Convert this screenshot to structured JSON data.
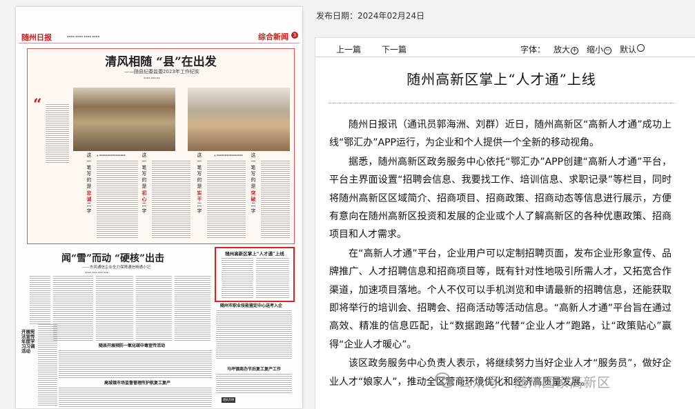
{
  "publish_date": "发布日期：2024年02月24日",
  "toolbar": {
    "prev_label": "上一篇",
    "next_label": "下一篇",
    "font_label": "字体：",
    "enlarge_label": "放大",
    "shrink_label": "缩小",
    "default_label": "默认"
  },
  "article": {
    "title": "随州高新区掌上“人才通”上线",
    "paragraphs": [
      "随州日报讯（通讯员郭海洲、刘群）近日，随州高新区“高新人才通”成功上线“鄂汇办”APP运行，为企业和个人提供一个全新的移动视角。",
      "据悉，随州高新区政务服务中心依托“鄂汇办”APP创建“高新人才通”平台，平台主界面设置“招聘会信息、我要找工作、培训信息、求职记录”等栏目，同时将随州高新区区域简介、招商项目、招商政策、招商动态等信息进行展示，方便有意向在随州高新区投资和发展的企业或个人了解高新区的各种优惠政策、招商项目和人才需求。",
      "在“高新人才通”平台，企业用户可以定制招聘页面，发布企业形象宣传、品牌推广、人才招聘信息和招商项目等，既有针对性地吸引所需人才，又拓宽合作渠道，加速项目落地。个人不仅可以手机浏览和申请最新的招聘信息，还能获取即将举行的培训会、招聘会、招商活动等活动信息。“高新人才通”平台旨在通过高效、精准的信息匹配，让“数据跑路”代替“企业人才”跑路，让“政策贴心”赢得“企业人才暖心”。",
      "该区政务服务中心负责人表示，将继续努力当好企业人才“服务员”，做好企业人才“娘家人”，推动全区营商环境优化和经济高质量发展。"
    ]
  },
  "watermark": "公众号 · 随州国家高新区",
  "newspaper": {
    "logo": "随州日报",
    "section": "综合新闻",
    "page_number": "3",
    "feature_headline": "清风相随 “县”在出发",
    "feature_subhead": "——随县纪委监委2023年工作纪实",
    "quote_mark": "“",
    "column_texts": [
      [
        "这",
        "一",
        "笔",
        "写",
        "的",
        "是",
        "忠",
        "诚",
        "二",
        "字"
      ],
      [
        "这",
        "一",
        "笔",
        "写",
        "的",
        "是",
        "初",
        "心",
        "二",
        "字"
      ],
      [
        "这",
        "一",
        "笔",
        "写",
        "的",
        "是",
        "实",
        "干",
        "二",
        "字"
      ],
      [
        "这",
        "一",
        "笔",
        "写",
        "的",
        "是",
        "突",
        "破",
        "二",
        "字"
      ]
    ],
    "story2_headline": "闻“雪”而动 “硬核”出击",
    "story2_subhead": "——东风通信企业全力保障通信畅通小记",
    "highlight_title": "随州高新区掌上“人才通”上线",
    "story3_headline": "随州市职业技能鉴定中心送考入企",
    "story4_headline": "随县开展预防一氧化碳中毒宣传活动",
    "story5_headline": "马坪镇商办节后复工复产工作",
    "story6_headline": "高城镇市场监督管理所护航复工复产",
    "left_vertical_headline": "开展宪法宣传年度学习习调活动",
    "notice_label": "遗失声明"
  },
  "colors": {
    "brand_red": "#c81e1e",
    "highlight_border": "#e02020",
    "body_text": "#111111"
  }
}
